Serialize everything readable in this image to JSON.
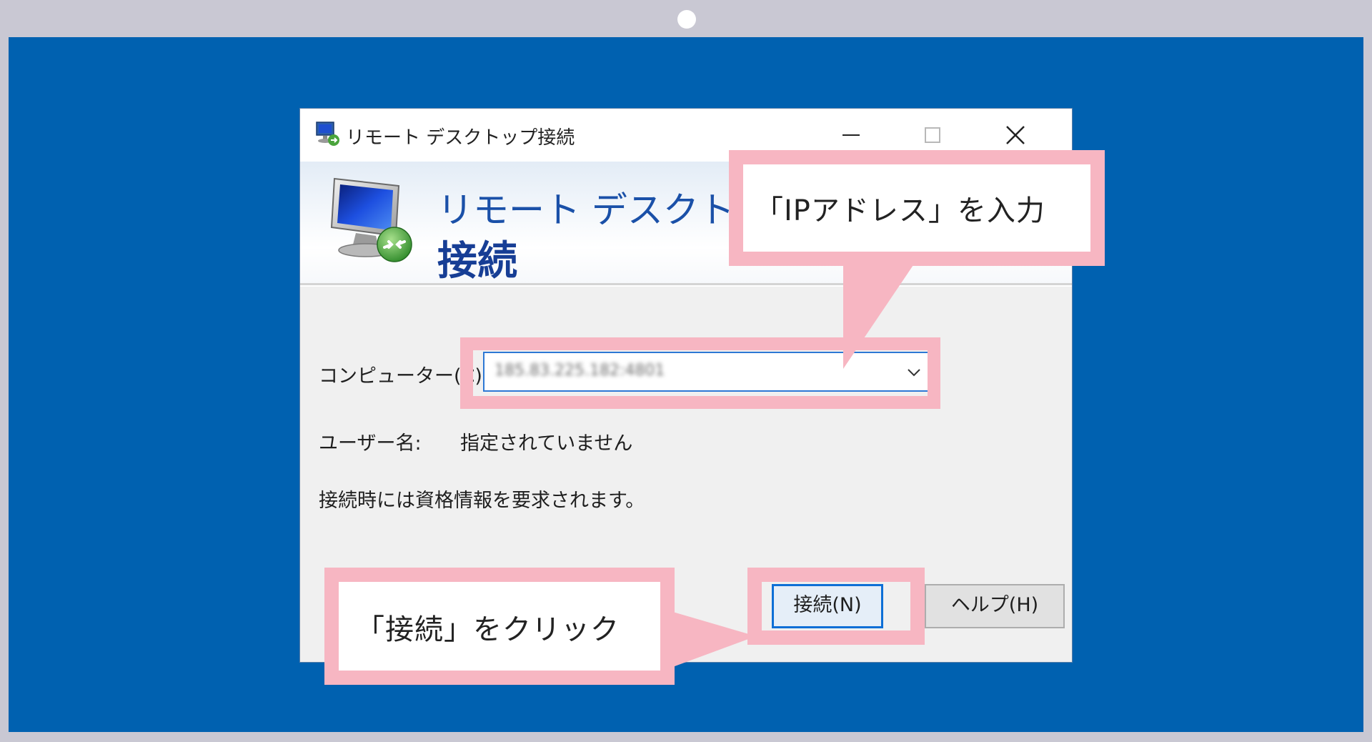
{
  "window": {
    "title": "リモート デスクトップ接続",
    "minimize_icon": "minimize-icon",
    "maximize_icon": "maximize-icon",
    "close_icon": "close-icon"
  },
  "banner": {
    "line1": "リモート デスクトップ",
    "line2": "接続",
    "icon": "remote-desktop-monitor-icon"
  },
  "form": {
    "computer_label": "コンピューター(C):",
    "computer_value": "185.83.225.182:4801",
    "username_label": "ユーザー名:",
    "username_value": "指定されていません",
    "info_text": "接続時には資格情報を要求されます。"
  },
  "buttons": {
    "connect_label": "接続(N)",
    "help_label": "ヘルプ(H)"
  },
  "callouts": {
    "ip_hint": "「IPアドレス」を入力",
    "click_hint": "「接続」をクリック"
  },
  "colors": {
    "desktop": "#0061b0",
    "bezel": "#c9c8d3",
    "callout": "#f7b6c2",
    "accent": "#2d78d4"
  }
}
